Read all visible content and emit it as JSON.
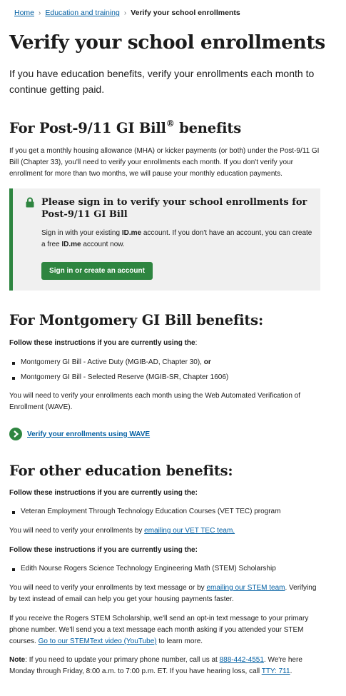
{
  "breadcrumb": {
    "home": "Home",
    "education": "Education and training",
    "current": "Verify your school enrollments",
    "separator": "›"
  },
  "page_title": "Verify your school enrollments",
  "lead": "If you have education benefits, verify your enrollments each month to continue getting paid.",
  "post911": {
    "heading": "For Post-9/11 GI Bill",
    "heading_mark": "®",
    "heading_suffix": " benefits",
    "body": "If you get a monthly housing allowance (MHA) or kicker payments (or both) under the Post-9/11 GI Bill (Chapter 33), you'll need to verify your enrollments each month. If you don't verify your enrollment for more than two months, we will pause your monthly education payments.",
    "alert": {
      "heading": "Please sign in to verify your school enrollments for Post-9/11 GI Bill",
      "text_1": "Sign in with your existing ",
      "idme": "ID.me",
      "text_2": " account. If you don't have an account, you can create a free ",
      "text_3": " account now.",
      "button_label": "Sign in or create an account",
      "icon": "lock-icon"
    }
  },
  "montgomery": {
    "heading": "For Montgomery GI Bill benefits:",
    "instruction": "Follow these instructions if you are currently using the",
    "instruction_colon": ":",
    "items": [
      {
        "text": "Montgomery GI Bill - Active Duty (MGIB-AD, Chapter 30), ",
        "emph": "or"
      },
      {
        "text": "Montgomery GI Bill - Selected Reserve (MGIB-SR, Chapter 1606)",
        "emph": ""
      }
    ],
    "body": "You will need to verify your enrollments each month using the Web Automated Verification of Enrollment (WAVE).",
    "action_link": "Verify your enrollments using WAVE",
    "action_icon": "chevron-right-icon"
  },
  "other": {
    "heading": "For other education benefits:",
    "instruction_1": "Follow these instructions if you are currently using the:",
    "item_1": "Veteran Employment Through Technology Education Courses (VET TEC) program",
    "vettec_text": "You will need to verify your enrollments by ",
    "vettec_link": "emailing our VET TEC team.",
    "instruction_2": "Follow these instructions if you are currently using the:",
    "item_2": "Edith Nourse Rogers Science Technology Engineering Math (STEM) Scholarship",
    "stem_text_1": "You will need to verify your enrollments by text message or by ",
    "stem_link": "emailing our STEM team",
    "stem_text_2": ". Verifying by text instead of email can help you get your housing payments faster.",
    "rogers_text": "If you receive the Rogers STEM Scholarship, we'll send an opt-in text message to your primary phone number. We'll send you a text message each month asking if you attended your STEM courses. ",
    "rogers_link": "Go to our STEMText video (YouTube)",
    "rogers_text_2": " to learn more.",
    "note_label": "Note",
    "note_text_1": ": If you need to update your primary phone number, call us at ",
    "phone": "888-442-4551",
    "note_text_2": ". We're here Monday through Friday, 8:00 a.m. to 7:00 p.m. ET. If you have hearing loss, call ",
    "tty": "TTY: 711",
    "note_text_3": "."
  },
  "colors": {
    "link": "#005ea2",
    "accent_green": "#2e8540",
    "alert_bg": "#f0f0f0",
    "text": "#1b1b1b"
  }
}
